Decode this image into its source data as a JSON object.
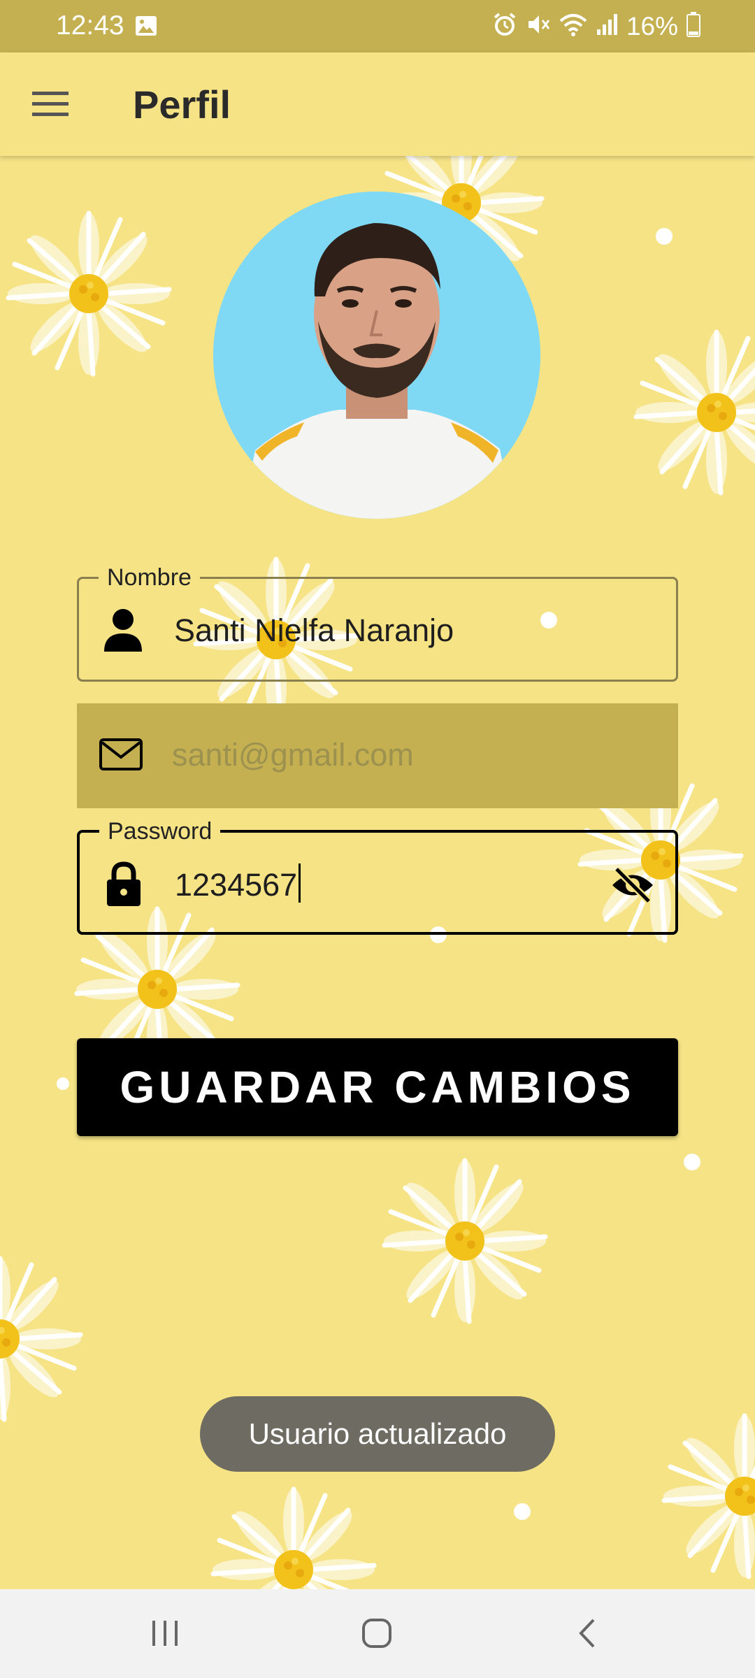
{
  "status_bar": {
    "time": "12:43",
    "battery": "16%",
    "icons": [
      "image-icon",
      "alarm-icon",
      "mute-icon",
      "wifi-icon",
      "signal-icon",
      "battery-icon"
    ]
  },
  "app_bar": {
    "title": "Perfil",
    "menu_icon": "hamburger-menu-icon"
  },
  "profile": {
    "avatar": "profile-photo"
  },
  "form": {
    "name": {
      "label": "Nombre",
      "value": "Santi Nielfa Naranjo",
      "icon": "person-icon"
    },
    "email": {
      "placeholder": "santi@gmail.com",
      "icon": "mail-icon"
    },
    "password": {
      "label": "Password",
      "value": "1234567",
      "icon": "lock-icon",
      "toggle_icon": "visibility-off-icon"
    }
  },
  "actions": {
    "save_label": "GUARDAR CAMBIOS"
  },
  "toast": {
    "message": "Usuario actualizado"
  },
  "nav_bar": {
    "recents_icon": "recents-icon",
    "home_icon": "home-icon",
    "back_icon": "back-icon"
  },
  "colors": {
    "background": "#f6e386",
    "status_bar": "#c4b050",
    "email_fill": "#c4b050",
    "button": "#000000",
    "toast": "#6e6b63"
  }
}
